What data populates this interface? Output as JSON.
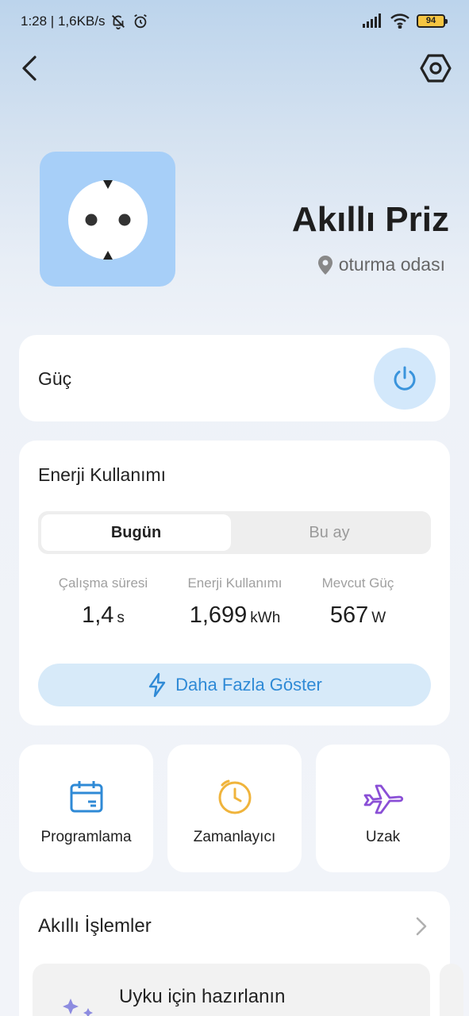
{
  "status_bar": {
    "time_info": "1:28 | 1,6KB/s",
    "battery": "94"
  },
  "device": {
    "name": "Akıllı Priz",
    "location": "oturma odası"
  },
  "power": {
    "label": "Güç"
  },
  "energy": {
    "title": "Enerji Kullanımı",
    "tabs": [
      "Bugün",
      "Bu ay"
    ],
    "stats": [
      {
        "label": "Çalışma süresi",
        "value": "1,4",
        "unit": "s"
      },
      {
        "label": "Enerji Kullanımı",
        "value": "1,699",
        "unit": "kWh"
      },
      {
        "label": "Mevcut Güç",
        "value": "567",
        "unit": "W"
      }
    ],
    "more_label": "Daha Fazla Göster"
  },
  "features": [
    {
      "label": "Programlama",
      "icon": "calendar-icon",
      "color": "#2f8ad6"
    },
    {
      "label": "Zamanlayıcı",
      "icon": "clock-icon",
      "color": "#f0b43c"
    },
    {
      "label": "Uzak",
      "icon": "airplane-icon",
      "color": "#8a4fd6"
    }
  ],
  "smart_actions": {
    "title": "Akıllı İşlemler",
    "scene": {
      "title": "Uyku için hazırlanın",
      "icon": "sparkle-icon"
    }
  },
  "colors": {
    "accent": "#2f8ad6",
    "device_tile": "#a7cff8",
    "power_button_bg": "#d3e8fb"
  }
}
